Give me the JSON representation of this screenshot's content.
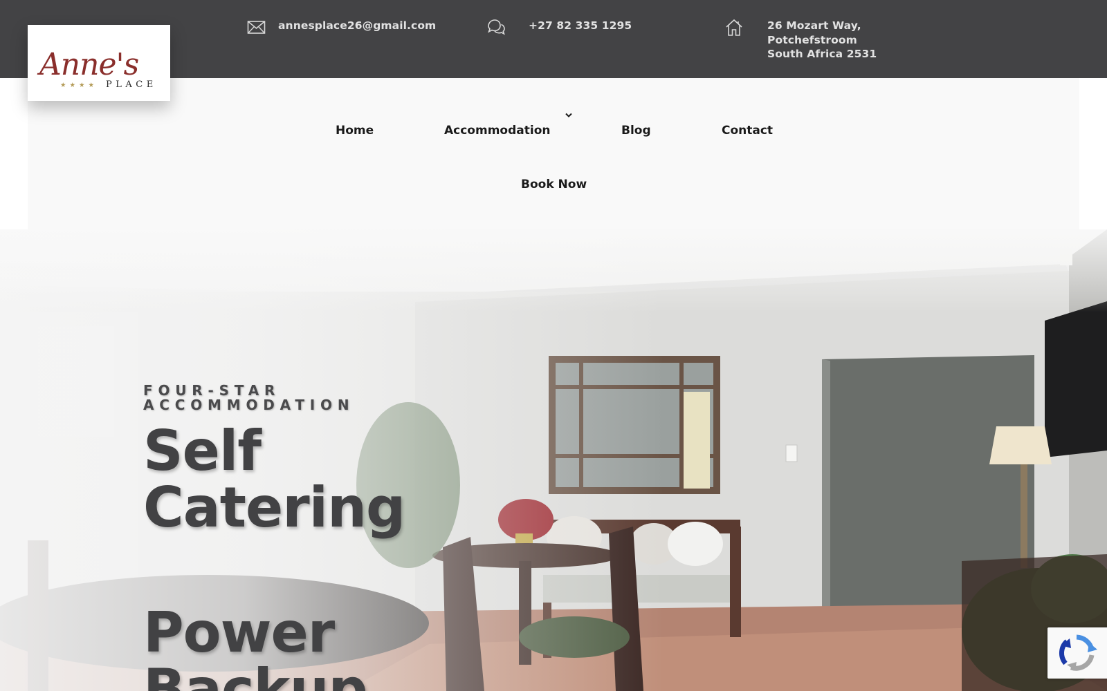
{
  "topbar": {
    "email": "annesplace26@gmail.com",
    "phone": "+27 82 335 1295",
    "address": [
      "26 Mozart Way,",
      "Potchefstroom",
      "South Africa 2531"
    ],
    "icons": {
      "email": "envelope-icon",
      "phone": "chat-bubbles-icon",
      "address": "home-icon"
    },
    "background": "#434345"
  },
  "logo": {
    "brand": "Anne's",
    "sub": "PLACE",
    "stars": "★★★★",
    "script_color": "#8a2e2b",
    "star_color": "#b39a55"
  },
  "nav": {
    "items": [
      "Home",
      "Accommodation",
      "Blog",
      "Contact"
    ],
    "book": "Book Now",
    "dropdown_icon": "chevron-down-icon",
    "background": "#f9f9f9"
  },
  "hero": {
    "eyebrow_line1": "FOUR-STAR",
    "eyebrow_line2": "ACCOMMODATION",
    "line1": "Self",
    "line2": "Catering",
    "line3": "Power",
    "line4": "Backup",
    "text_color": "#424244"
  },
  "recaptcha": {
    "icon": "recaptcha-icon"
  }
}
